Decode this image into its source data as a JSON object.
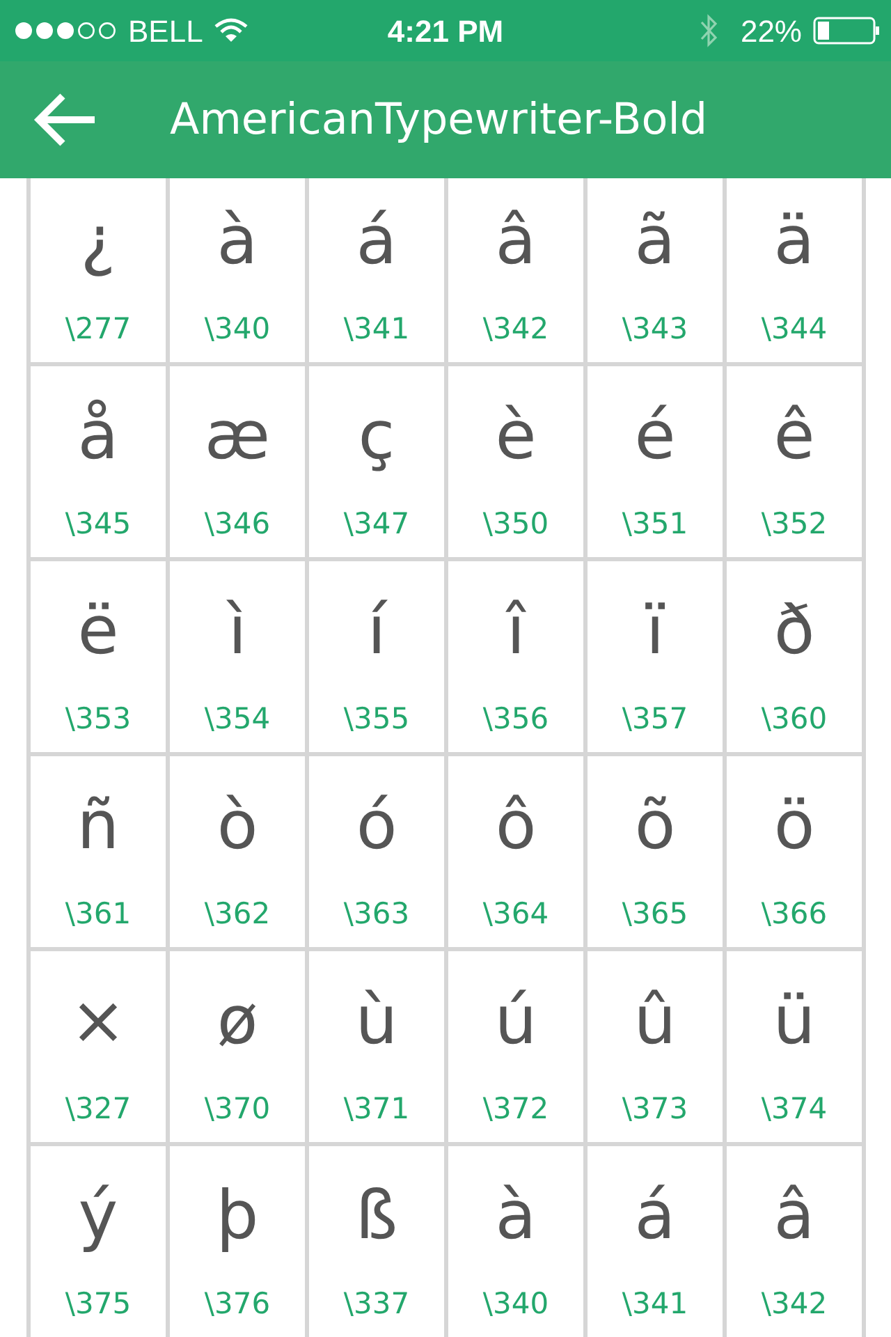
{
  "status_bar": {
    "carrier": "BELL",
    "time": "4:21 PM",
    "battery": "22%"
  },
  "header": {
    "title": "AmericanTypewriter-Bold"
  },
  "glyphs": [
    {
      "char": "¿",
      "code": "\\277"
    },
    {
      "char": "à",
      "code": "\\340"
    },
    {
      "char": "á",
      "code": "\\341"
    },
    {
      "char": "â",
      "code": "\\342"
    },
    {
      "char": "ã",
      "code": "\\343"
    },
    {
      "char": "ä",
      "code": "\\344"
    },
    {
      "char": "å",
      "code": "\\345"
    },
    {
      "char": "æ",
      "code": "\\346"
    },
    {
      "char": "ç",
      "code": "\\347"
    },
    {
      "char": "è",
      "code": "\\350"
    },
    {
      "char": "é",
      "code": "\\351"
    },
    {
      "char": "ê",
      "code": "\\352"
    },
    {
      "char": "ë",
      "code": "\\353"
    },
    {
      "char": "ì",
      "code": "\\354"
    },
    {
      "char": "í",
      "code": "\\355"
    },
    {
      "char": "î",
      "code": "\\356"
    },
    {
      "char": "ï",
      "code": "\\357"
    },
    {
      "char": "ð",
      "code": "\\360"
    },
    {
      "char": "ñ",
      "code": "\\361"
    },
    {
      "char": "ò",
      "code": "\\362"
    },
    {
      "char": "ó",
      "code": "\\363"
    },
    {
      "char": "ô",
      "code": "\\364"
    },
    {
      "char": "õ",
      "code": "\\365"
    },
    {
      "char": "ö",
      "code": "\\366"
    },
    {
      "char": "×",
      "code": "\\327"
    },
    {
      "char": "ø",
      "code": "\\370"
    },
    {
      "char": "ù",
      "code": "\\371"
    },
    {
      "char": "ú",
      "code": "\\372"
    },
    {
      "char": "û",
      "code": "\\373"
    },
    {
      "char": "ü",
      "code": "\\374"
    },
    {
      "char": "ý",
      "code": "\\375"
    },
    {
      "char": "þ",
      "code": "\\376"
    },
    {
      "char": "ß",
      "code": "\\337"
    },
    {
      "char": "à",
      "code": "\\340"
    },
    {
      "char": "á",
      "code": "\\341"
    },
    {
      "char": "â",
      "code": "\\342"
    }
  ]
}
